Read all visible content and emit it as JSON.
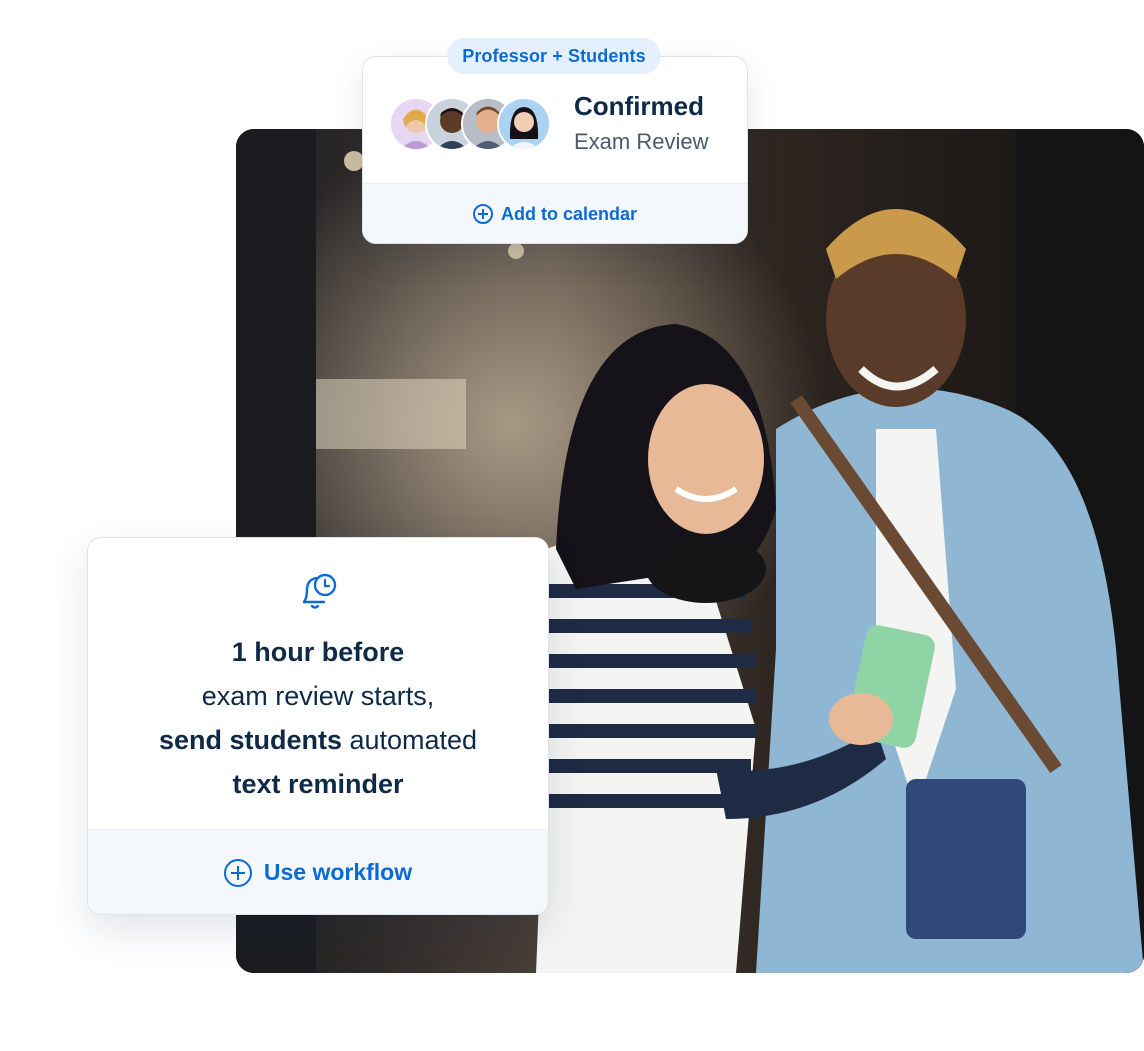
{
  "event_card": {
    "badge": "Professor + Students",
    "title": "Confirmed",
    "subtitle": "Exam Review",
    "action_label": "Add to calendar",
    "avatars": [
      "avatar-professor",
      "avatar-student-1",
      "avatar-student-2",
      "avatar-student-3"
    ]
  },
  "workflow_card": {
    "icon": "alarm-bell-icon",
    "line1_bold": "1 hour before",
    "line2": "exam review starts,",
    "line3_bold": "send students",
    "line3_rest": " automated",
    "line4_bold": "text reminder",
    "action_label": "Use workflow"
  },
  "photo": {
    "description_icon": "students-photo"
  },
  "colors": {
    "accent": "#0b6bd6",
    "text_dark": "#0f2a47",
    "badge_bg": "#e4f0fd",
    "footer_bg": "#f4f8fd"
  }
}
